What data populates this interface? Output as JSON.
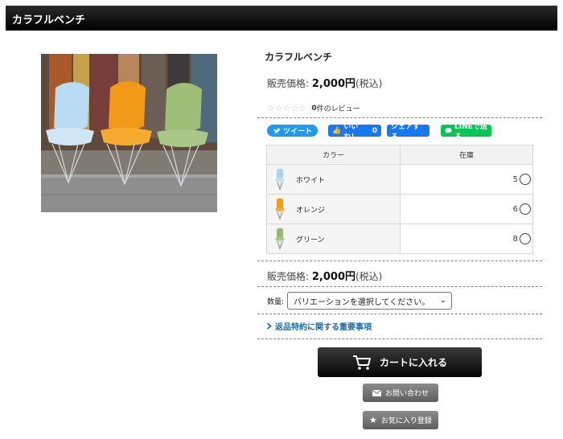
{
  "header": {
    "title": "カラフルベンチ"
  },
  "product": {
    "name": "カラフルベンチ",
    "price_label": "販売価格:",
    "price_value": "2,000円",
    "price_tax": "(税込)",
    "stars": "☆☆☆☆☆",
    "review_count": "0",
    "review_suffix": "件のレビュー"
  },
  "social": {
    "tweet": "ツイート",
    "like": "いいね！",
    "like_count": "0",
    "share": "シェアする",
    "line": "LINEで送る"
  },
  "variations": {
    "headers": [
      "カラー",
      "在庫"
    ],
    "rows": [
      {
        "color": "ホワイト",
        "stock": "5",
        "swatch": "#a9d3f0"
      },
      {
        "color": "オレンジ",
        "stock": "6",
        "swatch": "#f39a16"
      },
      {
        "color": "グリーン",
        "stock": "8",
        "swatch": "#96b872"
      }
    ]
  },
  "quantity": {
    "label": "数量:",
    "selected": "バリエーションを選択してください。"
  },
  "links": {
    "returns": "返品特約に関する重要事項"
  },
  "buttons": {
    "cart": "カートに入れる",
    "inquiry": "お問い合わせ",
    "favorite": "お気に入り登録"
  },
  "colors": {
    "header_bg": "#000000",
    "twitter": "#1d9bf0",
    "facebook": "#1877f2",
    "line": "#06c755",
    "link": "#1b6ea8"
  }
}
